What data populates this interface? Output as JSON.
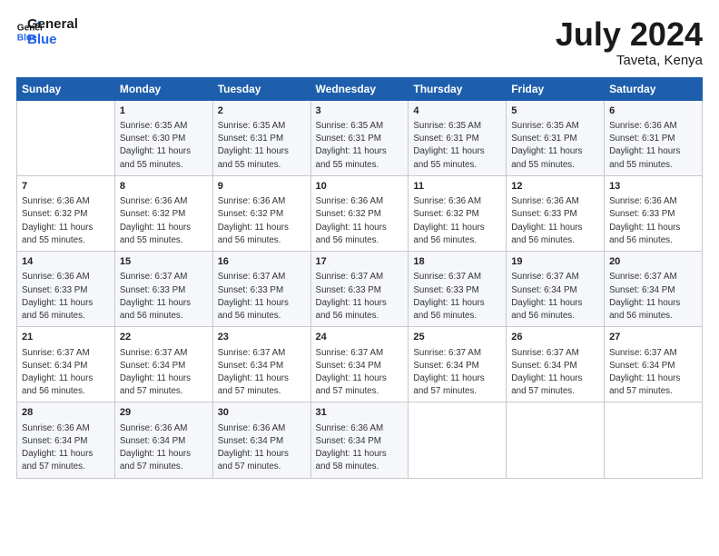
{
  "header": {
    "logo_line1": "General",
    "logo_line2": "Blue",
    "month": "July 2024",
    "location": "Taveta, Kenya"
  },
  "days_of_week": [
    "Sunday",
    "Monday",
    "Tuesday",
    "Wednesday",
    "Thursday",
    "Friday",
    "Saturday"
  ],
  "weeks": [
    [
      {
        "day": "",
        "info": ""
      },
      {
        "day": "1",
        "info": "Sunrise: 6:35 AM\nSunset: 6:30 PM\nDaylight: 11 hours\nand 55 minutes."
      },
      {
        "day": "2",
        "info": "Sunrise: 6:35 AM\nSunset: 6:31 PM\nDaylight: 11 hours\nand 55 minutes."
      },
      {
        "day": "3",
        "info": "Sunrise: 6:35 AM\nSunset: 6:31 PM\nDaylight: 11 hours\nand 55 minutes."
      },
      {
        "day": "4",
        "info": "Sunrise: 6:35 AM\nSunset: 6:31 PM\nDaylight: 11 hours\nand 55 minutes."
      },
      {
        "day": "5",
        "info": "Sunrise: 6:35 AM\nSunset: 6:31 PM\nDaylight: 11 hours\nand 55 minutes."
      },
      {
        "day": "6",
        "info": "Sunrise: 6:36 AM\nSunset: 6:31 PM\nDaylight: 11 hours\nand 55 minutes."
      }
    ],
    [
      {
        "day": "7",
        "info": "Sunrise: 6:36 AM\nSunset: 6:32 PM\nDaylight: 11 hours\nand 55 minutes."
      },
      {
        "day": "8",
        "info": "Sunrise: 6:36 AM\nSunset: 6:32 PM\nDaylight: 11 hours\nand 55 minutes."
      },
      {
        "day": "9",
        "info": "Sunrise: 6:36 AM\nSunset: 6:32 PM\nDaylight: 11 hours\nand 56 minutes."
      },
      {
        "day": "10",
        "info": "Sunrise: 6:36 AM\nSunset: 6:32 PM\nDaylight: 11 hours\nand 56 minutes."
      },
      {
        "day": "11",
        "info": "Sunrise: 6:36 AM\nSunset: 6:32 PM\nDaylight: 11 hours\nand 56 minutes."
      },
      {
        "day": "12",
        "info": "Sunrise: 6:36 AM\nSunset: 6:33 PM\nDaylight: 11 hours\nand 56 minutes."
      },
      {
        "day": "13",
        "info": "Sunrise: 6:36 AM\nSunset: 6:33 PM\nDaylight: 11 hours\nand 56 minutes."
      }
    ],
    [
      {
        "day": "14",
        "info": "Sunrise: 6:36 AM\nSunset: 6:33 PM\nDaylight: 11 hours\nand 56 minutes."
      },
      {
        "day": "15",
        "info": "Sunrise: 6:37 AM\nSunset: 6:33 PM\nDaylight: 11 hours\nand 56 minutes."
      },
      {
        "day": "16",
        "info": "Sunrise: 6:37 AM\nSunset: 6:33 PM\nDaylight: 11 hours\nand 56 minutes."
      },
      {
        "day": "17",
        "info": "Sunrise: 6:37 AM\nSunset: 6:33 PM\nDaylight: 11 hours\nand 56 minutes."
      },
      {
        "day": "18",
        "info": "Sunrise: 6:37 AM\nSunset: 6:33 PM\nDaylight: 11 hours\nand 56 minutes."
      },
      {
        "day": "19",
        "info": "Sunrise: 6:37 AM\nSunset: 6:34 PM\nDaylight: 11 hours\nand 56 minutes."
      },
      {
        "day": "20",
        "info": "Sunrise: 6:37 AM\nSunset: 6:34 PM\nDaylight: 11 hours\nand 56 minutes."
      }
    ],
    [
      {
        "day": "21",
        "info": "Sunrise: 6:37 AM\nSunset: 6:34 PM\nDaylight: 11 hours\nand 56 minutes."
      },
      {
        "day": "22",
        "info": "Sunrise: 6:37 AM\nSunset: 6:34 PM\nDaylight: 11 hours\nand 57 minutes."
      },
      {
        "day": "23",
        "info": "Sunrise: 6:37 AM\nSunset: 6:34 PM\nDaylight: 11 hours\nand 57 minutes."
      },
      {
        "day": "24",
        "info": "Sunrise: 6:37 AM\nSunset: 6:34 PM\nDaylight: 11 hours\nand 57 minutes."
      },
      {
        "day": "25",
        "info": "Sunrise: 6:37 AM\nSunset: 6:34 PM\nDaylight: 11 hours\nand 57 minutes."
      },
      {
        "day": "26",
        "info": "Sunrise: 6:37 AM\nSunset: 6:34 PM\nDaylight: 11 hours\nand 57 minutes."
      },
      {
        "day": "27",
        "info": "Sunrise: 6:37 AM\nSunset: 6:34 PM\nDaylight: 11 hours\nand 57 minutes."
      }
    ],
    [
      {
        "day": "28",
        "info": "Sunrise: 6:36 AM\nSunset: 6:34 PM\nDaylight: 11 hours\nand 57 minutes."
      },
      {
        "day": "29",
        "info": "Sunrise: 6:36 AM\nSunset: 6:34 PM\nDaylight: 11 hours\nand 57 minutes."
      },
      {
        "day": "30",
        "info": "Sunrise: 6:36 AM\nSunset: 6:34 PM\nDaylight: 11 hours\nand 57 minutes."
      },
      {
        "day": "31",
        "info": "Sunrise: 6:36 AM\nSunset: 6:34 PM\nDaylight: 11 hours\nand 58 minutes."
      },
      {
        "day": "",
        "info": ""
      },
      {
        "day": "",
        "info": ""
      },
      {
        "day": "",
        "info": ""
      }
    ]
  ]
}
